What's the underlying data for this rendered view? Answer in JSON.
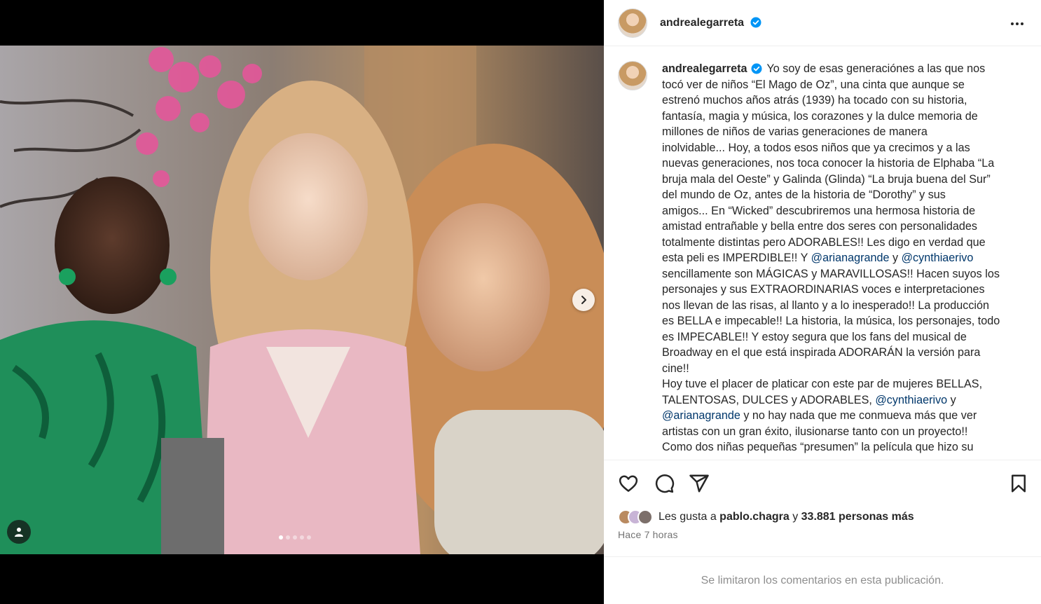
{
  "post": {
    "username": "andrealegarreta",
    "verified": true,
    "more_icon": "more-options-icon"
  },
  "media": {
    "carousel_total": 5,
    "carousel_active": 1,
    "next_icon": "chevron-right-icon",
    "tag_icon": "user-tag-icon"
  },
  "caption": {
    "username": "andrealegarreta",
    "lines": [
      "Yo soy de esas generaciónes a las que nos",
      "tocó ver de niños “El Mago de Oz”, una cinta que aunque se",
      "estrenó muchos años atrás (1939) ha tocado con su historia,",
      "fantasía, magia y música, los corazones y la dulce memoria de",
      "millones de niños de varias generaciones de manera",
      "inolvidable... Hoy, a todos esos niños que ya crecimos y a las",
      "nuevas generaciones, nos toca conocer la historia de Elphaba “La",
      "bruja mala del Oeste” y Galinda (Glinda) “La bruja buena del Sur”",
      "del mundo de Oz, antes de la historia de “Dorothy” y sus",
      "amigos... En “Wicked” descubriremos una hermosa historia de",
      "amistad entrañable y bella entre dos seres con personalidades",
      "totalmente distintas pero ADORABLES!! Les digo en verdad que"
    ],
    "line12_a": "esta peli es IMPERDIBLE!! Y ",
    "mention_ariana": "@arianagrande",
    "line12_b": " y ",
    "mention_cynthia": "@cynthiaerivo",
    "lines_b": [
      "sencillamente son MÁGICAS y MARAVILLOSAS!! Hacen suyos los",
      "personajes y sus EXTRAORDINARIAS voces e interpretaciones",
      "nos llevan de las risas, al llanto y a lo inesperado!! La producción",
      "es BELLA e impecable!! La historia, la música, los personajes, todo",
      "es IMPECABLE!! Y estoy segura que los fans del musical de",
      "Broadway en el que está inspirada ADORARÁN la versión para",
      "cine!!",
      "Hoy tuve el placer de platicar con este par de mujeres BELLAS,"
    ],
    "line21_a": "TALENTOSAS, DULCES y ADORABLES, ",
    "line21_b": " y",
    "line22_b": " y no hay nada que me conmueva más que ver",
    "lines_c": [
      "artistas con un gran éxito, ilusionarse tanto con un proyecto!!",
      "Como dos niñas pequeñas “presumen” la película que hizo su"
    ]
  },
  "actions": {
    "like_icon": "heart-icon",
    "comment_icon": "comment-icon",
    "share_icon": "share-icon",
    "save_icon": "bookmark-icon"
  },
  "likes": {
    "prefix": "Les gusta a ",
    "user": "pablo.chagra",
    "middle": " y ",
    "count": "33.881 personas más"
  },
  "timestamp": "Hace 7 horas",
  "comments_notice": "Se limitaron los comentarios en esta publicación.",
  "colors": {
    "link": "#00376b",
    "verified": "#0095f6",
    "border": "#efefef",
    "muted": "#737373"
  }
}
